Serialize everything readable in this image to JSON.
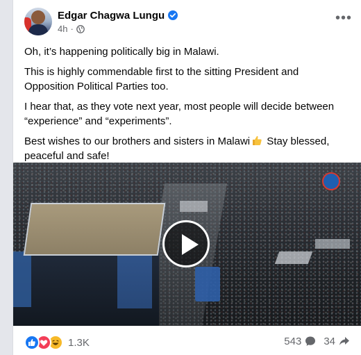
{
  "post": {
    "author": "Edgar Chagwa Lungu",
    "time": "4h",
    "separator": "·",
    "more_label": "•••",
    "paragraphs": [
      "Oh, it’s happening politically big in Malawi.",
      "This is highly commendable first to the sitting President and Opposition Political Parties too.",
      "I hear that, as they vote next year, most people will decide between “experience” and “experiments”."
    ],
    "last_paragraph_a": "Best wishes to our brothers and sisters in Malawi",
    "last_paragraph_b": " Stay blessed, peaceful and safe!"
  },
  "footer": {
    "reaction_count": "1.3K",
    "comment_count": "543",
    "share_count": "34"
  },
  "colors": {
    "accent": "#1877f2",
    "love": "#f33e58",
    "haha": "#f7b928",
    "muted_text": "#65676b"
  },
  "icons": [
    "verified-badge-icon",
    "globe-icon",
    "more-options-icon",
    "thumbs-up-emoji",
    "play-icon",
    "like-reaction-icon",
    "love-reaction-icon",
    "haha-reaction-icon",
    "comment-icon",
    "share-icon"
  ]
}
